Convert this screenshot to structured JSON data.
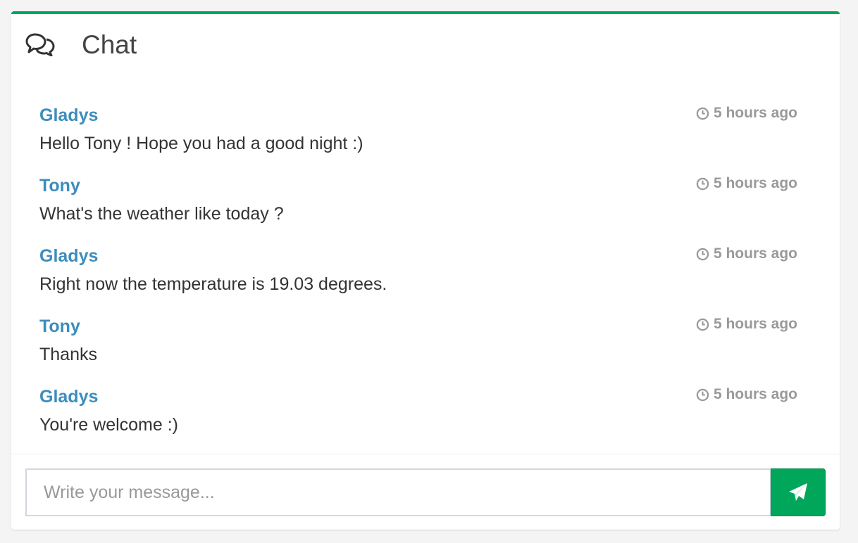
{
  "header": {
    "title": "Chat",
    "icon": "comments-icon"
  },
  "messages": [
    {
      "name": "Gladys",
      "time": "5 hours ago",
      "text": "Hello Tony ! Hope you had a good night :)"
    },
    {
      "name": "Tony",
      "time": "5 hours ago",
      "text": "What's the weather like today ?"
    },
    {
      "name": "Gladys",
      "time": "5 hours ago",
      "text": "Right now the temperature is 19.03 degrees."
    },
    {
      "name": "Tony",
      "time": "5 hours ago",
      "text": "Thanks"
    },
    {
      "name": "Gladys",
      "time": "5 hours ago",
      "text": "You're welcome :)"
    }
  ],
  "footer": {
    "placeholder": "Write your message...",
    "send_icon": "paper-plane-icon"
  },
  "colors": {
    "accent": "#00a65a",
    "name": "#3c8dbc",
    "time": "#999999"
  }
}
